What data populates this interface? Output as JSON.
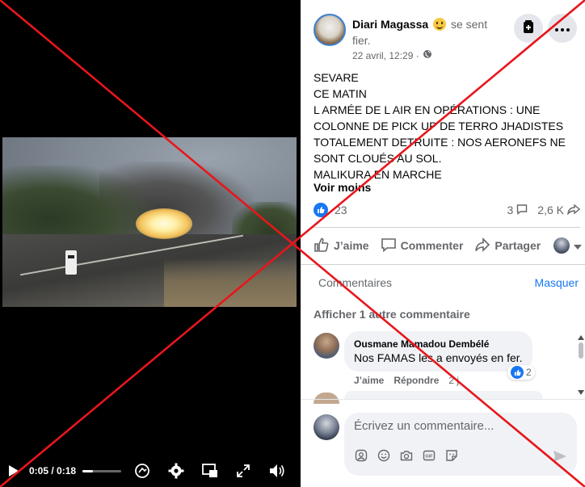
{
  "video": {
    "time": "0:05 / 0:18",
    "progress_fraction": 0.28
  },
  "post": {
    "author_name": "Diari Magassa",
    "status": "se sent fier.",
    "timestamp": "22 avril, 12:29 ·",
    "text": "SEVARE\nCE MATIN\nL ARMÉE DE L AIR EN OPÉRATIONS : UNE COLONNE DE PICK UP DE TERRO JHADISTES TOTALEMENT DETRUITE : NOS AERONEFS NE SONT CLOUÉS AU SOL.\nMALIKURA EN MARCHE",
    "see_less": "Voir moins",
    "reactions_count": "23",
    "comments_count": "3",
    "shares_count": "2,6 K"
  },
  "actions": {
    "like": "J’aime",
    "comment": "Commenter",
    "share": "Partager"
  },
  "comments_header": {
    "title": "Commentaires",
    "hide": "Masquer",
    "more": "Afficher 1 autre commentaire"
  },
  "comment": {
    "author": "Ousmane Mamadou Dembélé",
    "text": "Nos FAMAS les a envoyés en fer.",
    "likes": "2",
    "like": "J’aime",
    "reply": "Répondre",
    "age": "2 j"
  },
  "composer": {
    "placeholder": "Écrivez un commentaire..."
  },
  "colors": {
    "facebook_blue": "#1877f2",
    "overlay_red": "#e8161b"
  }
}
